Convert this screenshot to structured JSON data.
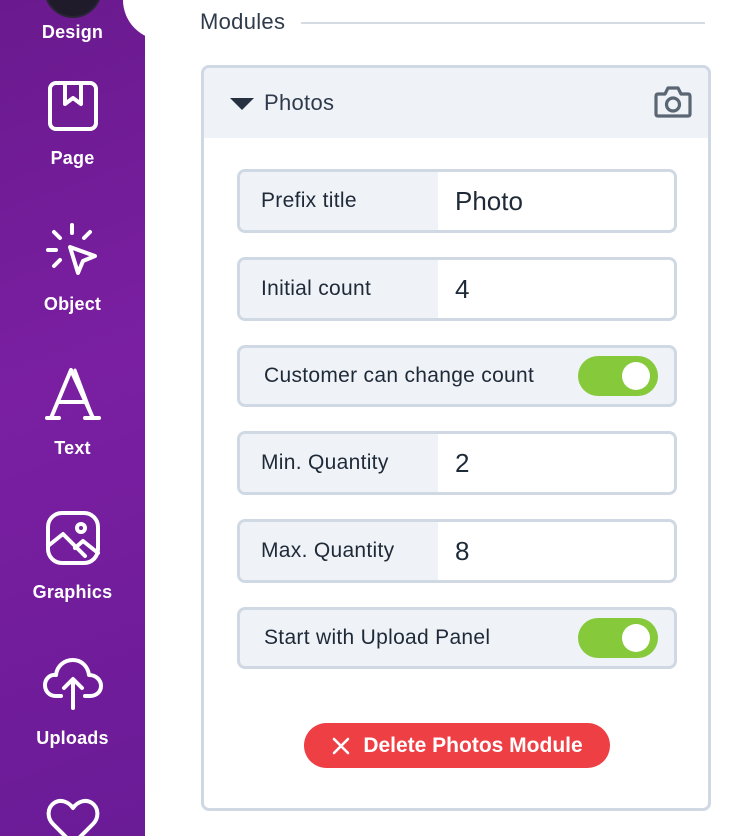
{
  "sidebar": {
    "items": [
      {
        "label": "Design",
        "icon": "avatar"
      },
      {
        "label": "Page",
        "icon": "bookmark-page-icon"
      },
      {
        "label": "Object",
        "icon": "cursor-click-icon"
      },
      {
        "label": "Text",
        "icon": "letter-a-icon"
      },
      {
        "label": "Graphics",
        "icon": "image-icon"
      },
      {
        "label": "Uploads",
        "icon": "cloud-upload-icon"
      },
      {
        "label": "",
        "icon": "heart-icon"
      }
    ]
  },
  "modules": {
    "title": "Modules",
    "panel": {
      "title": "Photos",
      "camera_icon": "camera-icon",
      "prefix_title": {
        "label": "Prefix title",
        "value": "Photo"
      },
      "initial_count": {
        "label": "Initial count",
        "value": "4"
      },
      "customer_change_count": {
        "label": "Customer can change count",
        "enabled": true
      },
      "min_quantity": {
        "label": "Min. Quantity",
        "value": "2"
      },
      "max_quantity": {
        "label": "Max. Quantity",
        "value": "8"
      },
      "start_upload_panel": {
        "label": "Start with Upload Panel",
        "enabled": true
      },
      "delete_label": "Delete Photos Module"
    }
  },
  "colors": {
    "sidebar_bg": "#7a1fa2",
    "toggle_on": "#86c93a",
    "delete_button": "#ee3f45",
    "border": "#cfd8e3"
  }
}
